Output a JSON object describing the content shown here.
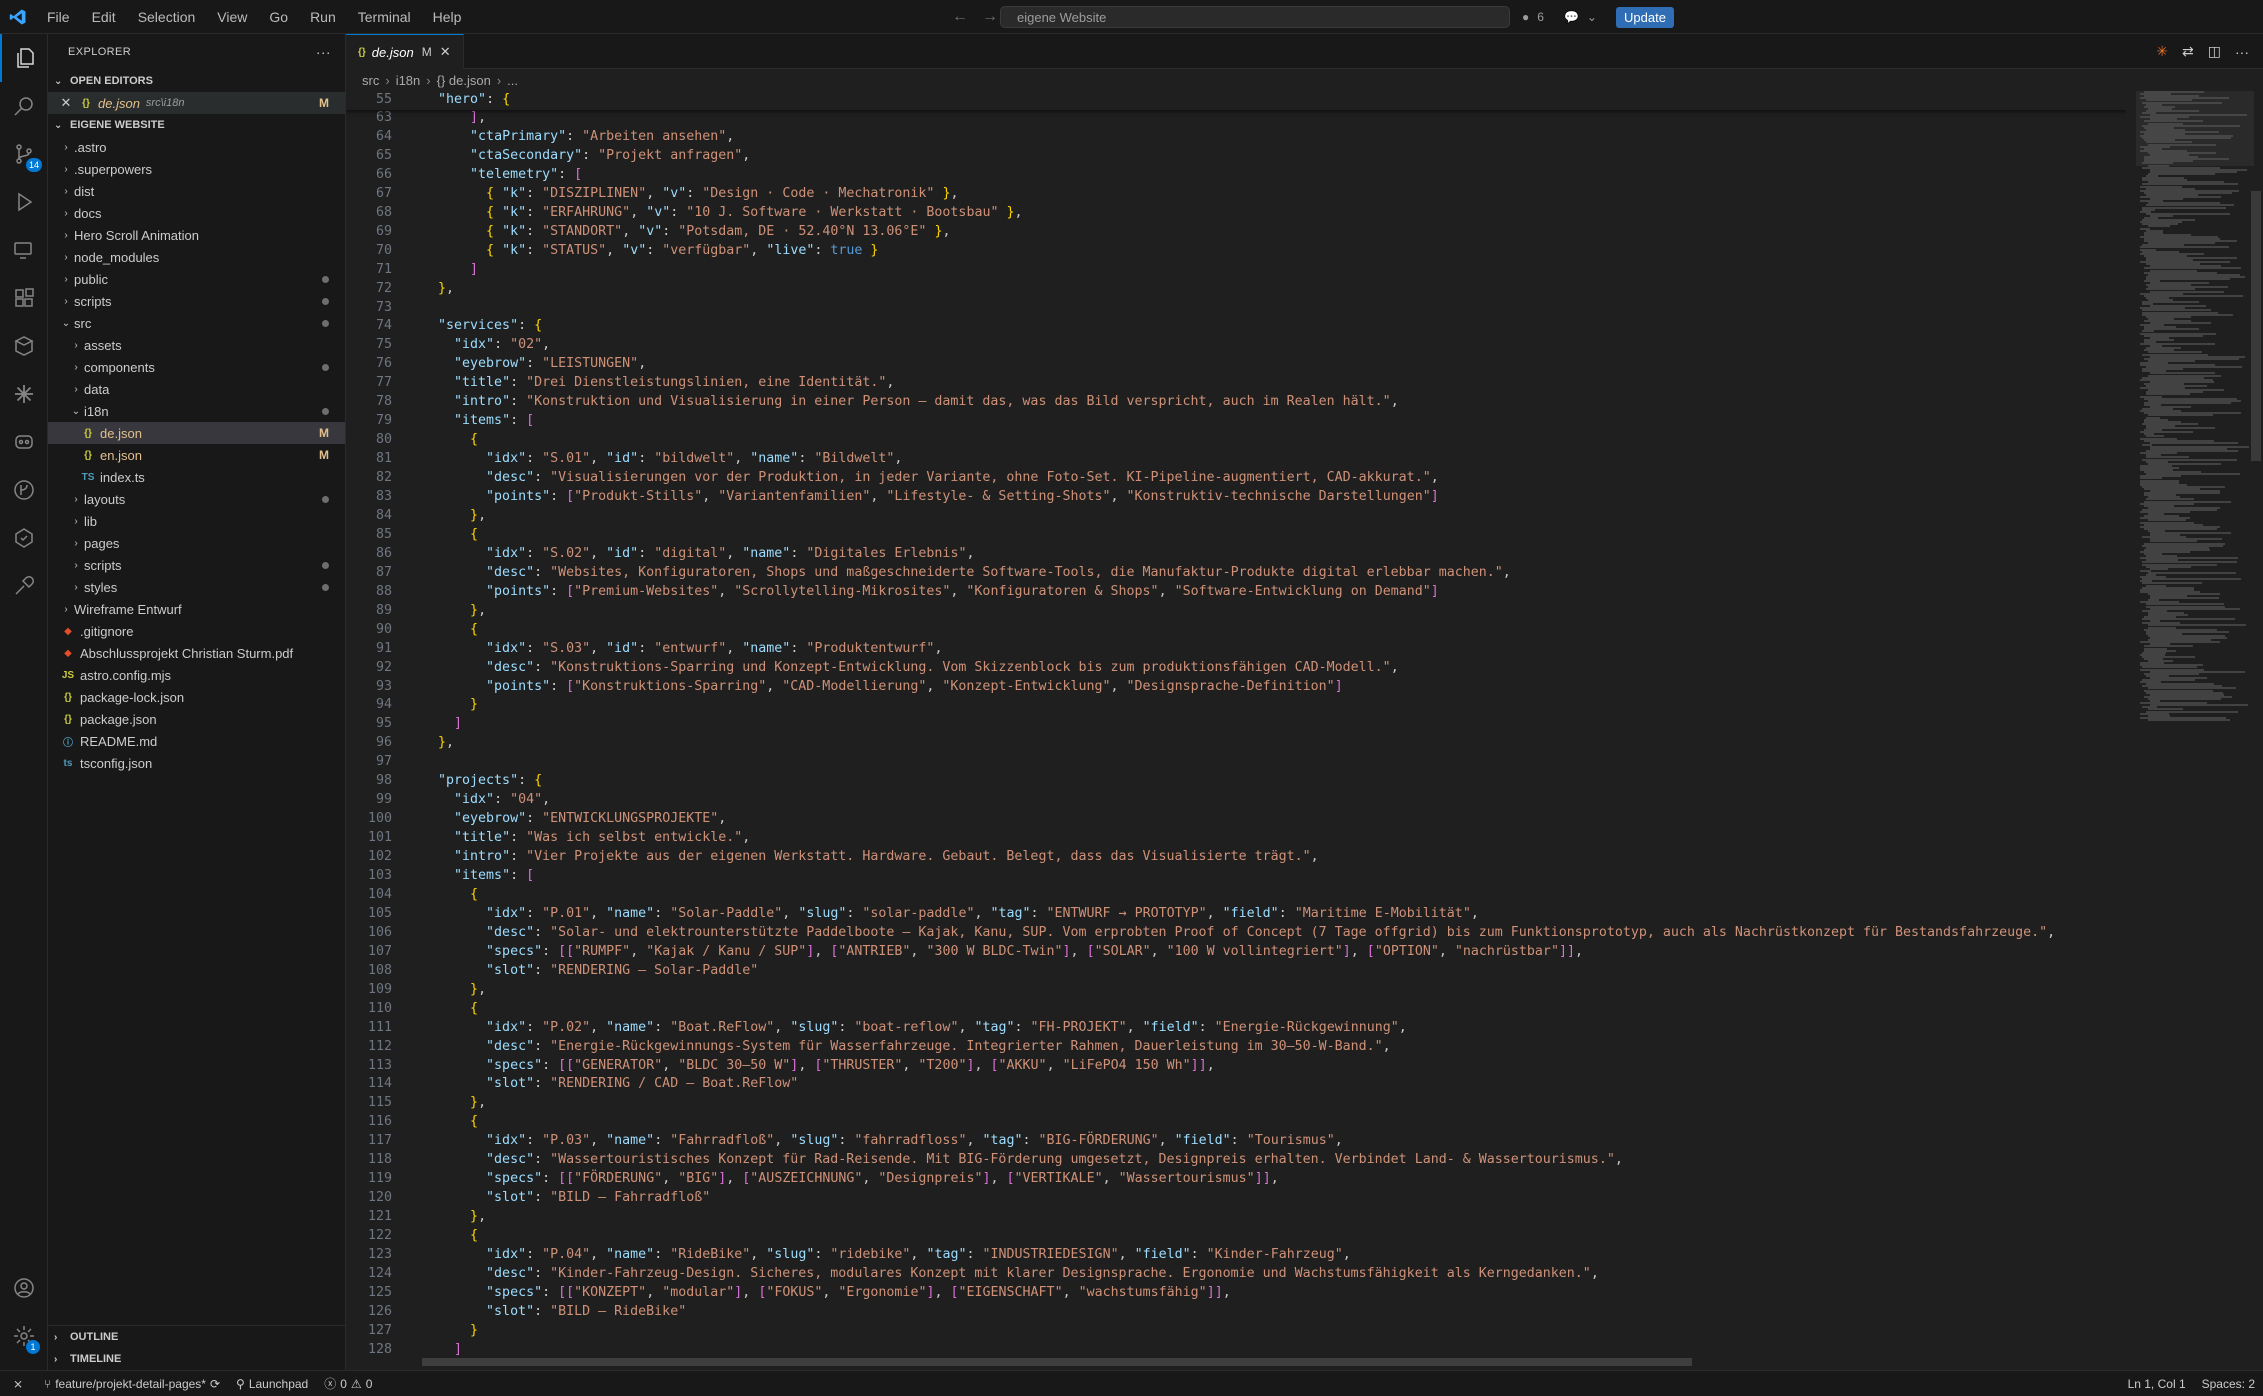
{
  "titlebar": {
    "menu": [
      "File",
      "Edit",
      "Selection",
      "View",
      "Go",
      "Run",
      "Terminal",
      "Help"
    ],
    "search_text": "eigene Website",
    "copilot_count": "6",
    "update_label": "Update"
  },
  "activity": {
    "scm_badge": "14",
    "settings_badge": "1"
  },
  "sidebar": {
    "title": "EXPLORER",
    "open_editors_label": "OPEN EDITORS",
    "open_editor": {
      "name": "de.json",
      "path": "src\\i18n",
      "status": "M"
    },
    "workspace_label": "EIGENE WEBSITE",
    "tree": [
      {
        "label": ".astro",
        "depth": 0,
        "type": "folder",
        "open": false,
        "dot": false
      },
      {
        "label": ".superpowers",
        "depth": 0,
        "type": "folder",
        "open": false,
        "dot": false
      },
      {
        "label": "dist",
        "depth": 0,
        "type": "folder",
        "open": false,
        "dot": false
      },
      {
        "label": "docs",
        "depth": 0,
        "type": "folder",
        "open": false,
        "dot": false
      },
      {
        "label": "Hero Scroll Animation",
        "depth": 0,
        "type": "folder",
        "open": false,
        "dot": false
      },
      {
        "label": "node_modules",
        "depth": 0,
        "type": "folder",
        "open": false,
        "dot": false
      },
      {
        "label": "public",
        "depth": 0,
        "type": "folder",
        "open": false,
        "dot": true
      },
      {
        "label": "scripts",
        "depth": 0,
        "type": "folder",
        "open": false,
        "dot": true
      },
      {
        "label": "src",
        "depth": 0,
        "type": "folder",
        "open": true,
        "dot": true
      },
      {
        "label": "assets",
        "depth": 1,
        "type": "folder",
        "open": false,
        "dot": false
      },
      {
        "label": "components",
        "depth": 1,
        "type": "folder",
        "open": false,
        "dot": true
      },
      {
        "label": "data",
        "depth": 1,
        "type": "folder",
        "open": false,
        "dot": false
      },
      {
        "label": "i18n",
        "depth": 1,
        "type": "folder",
        "open": true,
        "dot": true
      },
      {
        "label": "de.json",
        "depth": 2,
        "type": "json",
        "status": "M",
        "selected": true
      },
      {
        "label": "en.json",
        "depth": 2,
        "type": "json",
        "status": "M"
      },
      {
        "label": "index.ts",
        "depth": 2,
        "type": "ts"
      },
      {
        "label": "layouts",
        "depth": 1,
        "type": "folder",
        "open": false,
        "dot": true
      },
      {
        "label": "lib",
        "depth": 1,
        "type": "folder",
        "open": false,
        "dot": false
      },
      {
        "label": "pages",
        "depth": 1,
        "type": "folder",
        "open": false,
        "dot": false
      },
      {
        "label": "scripts",
        "depth": 1,
        "type": "folder",
        "open": false,
        "dot": true
      },
      {
        "label": "styles",
        "depth": 1,
        "type": "folder",
        "open": false,
        "dot": true
      },
      {
        "label": "Wireframe Entwurf",
        "depth": 0,
        "type": "folder",
        "open": false,
        "dot": false
      },
      {
        "label": ".gitignore",
        "depth": 0,
        "type": "git"
      },
      {
        "label": "Abschlussprojekt Christian Sturm.pdf",
        "depth": 0,
        "type": "pdf"
      },
      {
        "label": "astro.config.mjs",
        "depth": 0,
        "type": "js"
      },
      {
        "label": "package-lock.json",
        "depth": 0,
        "type": "json"
      },
      {
        "label": "package.json",
        "depth": 0,
        "type": "json"
      },
      {
        "label": "README.md",
        "depth": 0,
        "type": "md"
      },
      {
        "label": "tsconfig.json",
        "depth": 0,
        "type": "tsconfig"
      }
    ],
    "outline_label": "OUTLINE",
    "timeline_label": "TIMELINE"
  },
  "editor": {
    "tab": {
      "name": "de.json",
      "status": "M"
    },
    "breadcrumb": [
      "src",
      "i18n",
      "{} de.json",
      "..."
    ],
    "sticky_line": {
      "num": "55",
      "text": "  \"hero\": {"
    },
    "lines": [
      {
        "num": "63",
        "text": "      ],"
      },
      {
        "num": "64",
        "text": "      \"ctaPrimary\": \"Arbeiten ansehen\","
      },
      {
        "num": "65",
        "text": "      \"ctaSecondary\": \"Projekt anfragen\","
      },
      {
        "num": "66",
        "text": "      \"telemetry\": ["
      },
      {
        "num": "67",
        "text": "        { \"k\": \"DISZIPLINEN\", \"v\": \"Design · Code · Mechatronik\" },"
      },
      {
        "num": "68",
        "text": "        { \"k\": \"ERFAHRUNG\", \"v\": \"10 J. Software · Werkstatt · Bootsbau\" },"
      },
      {
        "num": "69",
        "text": "        { \"k\": \"STANDORT\", \"v\": \"Potsdam, DE · 52.40°N 13.06°E\" },"
      },
      {
        "num": "70",
        "text": "        { \"k\": \"STATUS\", \"v\": \"verfügbar\", \"live\": true }"
      },
      {
        "num": "71",
        "text": "      ]"
      },
      {
        "num": "72",
        "text": "  },"
      },
      {
        "num": "73",
        "text": ""
      },
      {
        "num": "74",
        "text": "  \"services\": {"
      },
      {
        "num": "75",
        "text": "    \"idx\": \"02\","
      },
      {
        "num": "76",
        "text": "    \"eyebrow\": \"LEISTUNGEN\","
      },
      {
        "num": "77",
        "text": "    \"title\": \"Drei Dienstleistungslinien, eine Identität.\","
      },
      {
        "num": "78",
        "text": "    \"intro\": \"Konstruktion und Visualisierung in einer Person — damit das, was das Bild verspricht, auch im Realen hält.\","
      },
      {
        "num": "79",
        "text": "    \"items\": ["
      },
      {
        "num": "80",
        "text": "      {"
      },
      {
        "num": "81",
        "text": "        \"idx\": \"S.01\", \"id\": \"bildwelt\", \"name\": \"Bildwelt\","
      },
      {
        "num": "82",
        "text": "        \"desc\": \"Visualisierungen vor der Produktion, in jeder Variante, ohne Foto-Set. KI-Pipeline-augmentiert, CAD-akkurat.\","
      },
      {
        "num": "83",
        "text": "        \"points\": [\"Produkt-Stills\", \"Variantenfamilien\", \"Lifestyle- & Setting-Shots\", \"Konstruktiv-technische Darstellungen\"]"
      },
      {
        "num": "84",
        "text": "      },"
      },
      {
        "num": "85",
        "text": "      {"
      },
      {
        "num": "86",
        "text": "        \"idx\": \"S.02\", \"id\": \"digital\", \"name\": \"Digitales Erlebnis\","
      },
      {
        "num": "87",
        "text": "        \"desc\": \"Websites, Konfiguratoren, Shops und maßgeschneiderte Software-Tools, die Manufaktur-Produkte digital erlebbar machen.\","
      },
      {
        "num": "88",
        "text": "        \"points\": [\"Premium-Websites\", \"Scrollytelling-Mikrosites\", \"Konfiguratoren & Shops\", \"Software-Entwicklung on Demand\"]"
      },
      {
        "num": "89",
        "text": "      },"
      },
      {
        "num": "90",
        "text": "      {"
      },
      {
        "num": "91",
        "text": "        \"idx\": \"S.03\", \"id\": \"entwurf\", \"name\": \"Produktentwurf\","
      },
      {
        "num": "92",
        "text": "        \"desc\": \"Konstruktions-Sparring und Konzept-Entwicklung. Vom Skizzenblock bis zum produktionsfähigen CAD-Modell.\","
      },
      {
        "num": "93",
        "text": "        \"points\": [\"Konstruktions-Sparring\", \"CAD-Modellierung\", \"Konzept-Entwicklung\", \"Designsprache-Definition\"]"
      },
      {
        "num": "94",
        "text": "      }"
      },
      {
        "num": "95",
        "text": "    ]"
      },
      {
        "num": "96",
        "text": "  },"
      },
      {
        "num": "97",
        "text": ""
      },
      {
        "num": "98",
        "text": "  \"projects\": {"
      },
      {
        "num": "99",
        "text": "    \"idx\": \"04\","
      },
      {
        "num": "100",
        "text": "    \"eyebrow\": \"ENTWICKLUNGSPROJEKTE\","
      },
      {
        "num": "101",
        "text": "    \"title\": \"Was ich selbst entwickle.\","
      },
      {
        "num": "102",
        "text": "    \"intro\": \"Vier Projekte aus der eigenen Werkstatt. Hardware. Gebaut. Belegt, dass das Visualisierte trägt.\","
      },
      {
        "num": "103",
        "text": "    \"items\": ["
      },
      {
        "num": "104",
        "text": "      {"
      },
      {
        "num": "105",
        "text": "        \"idx\": \"P.01\", \"name\": \"Solar-Paddle\", \"slug\": \"solar-paddle\", \"tag\": \"ENTWURF → PROTOTYP\", \"field\": \"Maritime E-Mobilität\","
      },
      {
        "num": "106",
        "text": "        \"desc\": \"Solar- und elektrounterstützte Paddelboote — Kajak, Kanu, SUP. Vom erprobten Proof of Concept (7 Tage offgrid) bis zum Funktionsprototyp, auch als Nachrüstkonzept für Bestandsfahrzeuge.\","
      },
      {
        "num": "107",
        "text": "        \"specs\": [[\"RUMPF\", \"Kajak / Kanu / SUP\"], [\"ANTRIEB\", \"300 W BLDC-Twin\"], [\"SOLAR\", \"100 W vollintegriert\"], [\"OPTION\", \"nachrüstbar\"]],"
      },
      {
        "num": "108",
        "text": "        \"slot\": \"RENDERING — Solar-Paddle\""
      },
      {
        "num": "109",
        "text": "      },"
      },
      {
        "num": "110",
        "text": "      {"
      },
      {
        "num": "111",
        "text": "        \"idx\": \"P.02\", \"name\": \"Boat.ReFlow\", \"slug\": \"boat-reflow\", \"tag\": \"FH-PROJEKT\", \"field\": \"Energie-Rückgewinnung\","
      },
      {
        "num": "112",
        "text": "        \"desc\": \"Energie-Rückgewinnungs-System für Wasserfahrzeuge. Integrierter Rahmen, Dauerleistung im 30–50-W-Band.\","
      },
      {
        "num": "113",
        "text": "        \"specs\": [[\"GENERATOR\", \"BLDC 30–50 W\"], [\"THRUSTER\", \"T200\"], [\"AKKU\", \"LiFePO4 150 Wh\"]],"
      },
      {
        "num": "114",
        "text": "        \"slot\": \"RENDERING / CAD — Boat.ReFlow\""
      },
      {
        "num": "115",
        "text": "      },"
      },
      {
        "num": "116",
        "text": "      {"
      },
      {
        "num": "117",
        "text": "        \"idx\": \"P.03\", \"name\": \"Fahrradfloß\", \"slug\": \"fahrradfloss\", \"tag\": \"BIG-FÖRDERUNG\", \"field\": \"Tourismus\","
      },
      {
        "num": "118",
        "text": "        \"desc\": \"Wassertouristisches Konzept für Rad-Reisende. Mit BIG-Förderung umgesetzt, Designpreis erhalten. Verbindet Land- & Wassertourismus.\","
      },
      {
        "num": "119",
        "text": "        \"specs\": [[\"FÖRDERUNG\", \"BIG\"], [\"AUSZEICHNUNG\", \"Designpreis\"], [\"VERTIKALE\", \"Wassertourismus\"]],"
      },
      {
        "num": "120",
        "text": "        \"slot\": \"BILD — Fahrradfloß\""
      },
      {
        "num": "121",
        "text": "      },"
      },
      {
        "num": "122",
        "text": "      {"
      },
      {
        "num": "123",
        "text": "        \"idx\": \"P.04\", \"name\": \"RideBike\", \"slug\": \"ridebike\", \"tag\": \"INDUSTRIEDESIGN\", \"field\": \"Kinder-Fahrzeug\","
      },
      {
        "num": "124",
        "text": "        \"desc\": \"Kinder-Fahrzeug-Design. Sicheres, modulares Konzept mit klarer Designsprache. Ergonomie und Wachstumsfähigkeit als Kerngedanken.\","
      },
      {
        "num": "125",
        "text": "        \"specs\": [[\"KONZEPT\", \"modular\"], [\"FOKUS\", \"Ergonomie\"], [\"EIGENSCHAFT\", \"wachstumsfähig\"]],"
      },
      {
        "num": "126",
        "text": "        \"slot\": \"BILD — RideBike\""
      },
      {
        "num": "127",
        "text": "      }"
      },
      {
        "num": "128",
        "text": "    ]"
      }
    ]
  },
  "statusbar": {
    "branch": "feature/projekt-detail-pages*",
    "launchpad": "Launchpad",
    "errors": "0",
    "warnings": "0",
    "position": "Ln 1, Col 1",
    "spaces": "Spaces: 2"
  }
}
